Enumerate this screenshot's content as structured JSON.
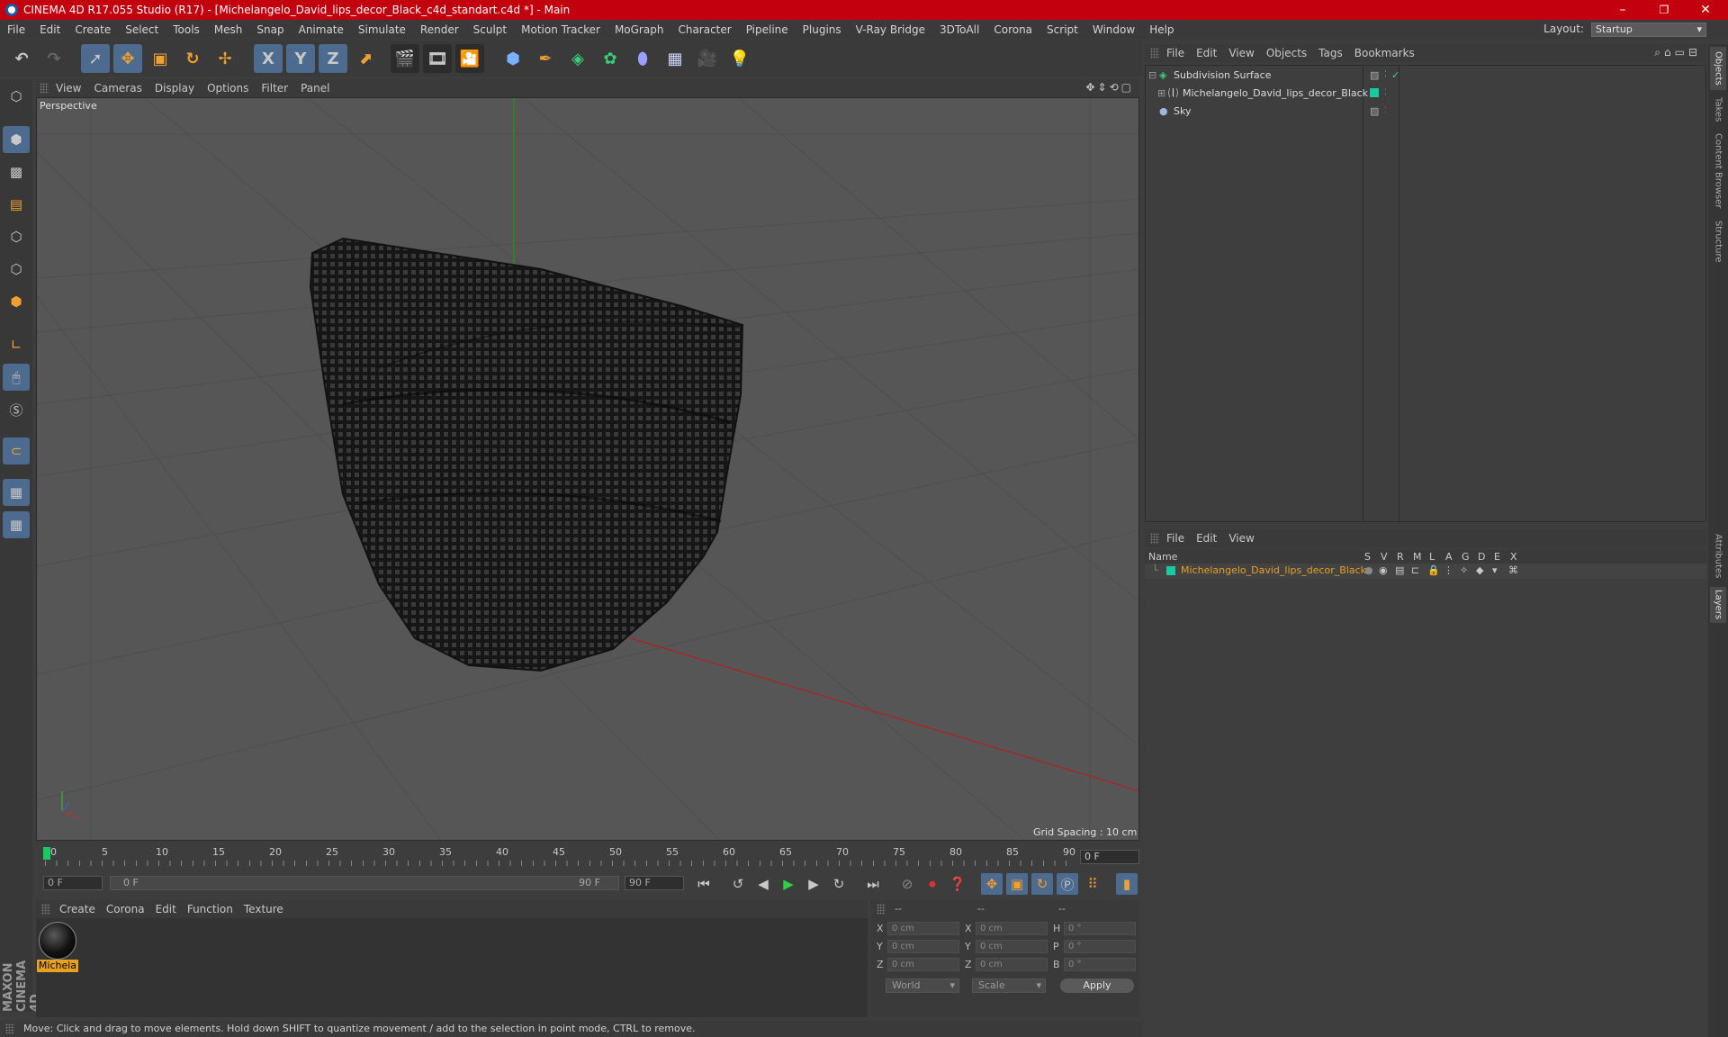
{
  "window": {
    "title": "CINEMA 4D R17.055 Studio (R17) - [Michelangelo_David_lips_decor_Black_c4d_standart.c4d *] - Main",
    "min_glyph": "–",
    "max_glyph": "❐",
    "close_glyph": "✕"
  },
  "menu": [
    "File",
    "Edit",
    "Create",
    "Select",
    "Tools",
    "Mesh",
    "Snap",
    "Animate",
    "Simulate",
    "Render",
    "Sculpt",
    "Motion Tracker",
    "MoGraph",
    "Character",
    "Pipeline",
    "Plugins",
    "V-Ray Bridge",
    "3DToAll",
    "Corona",
    "Script",
    "Window",
    "Help"
  ],
  "layout": {
    "label": "Layout:",
    "value": "Startup"
  },
  "toolbar": {
    "x_label": "X",
    "y_label": "Y",
    "z_label": "Z"
  },
  "viewport": {
    "menu": [
      "View",
      "Cameras",
      "Display",
      "Options",
      "Filter",
      "Panel"
    ],
    "label": "Perspective",
    "grid_spacing": "Grid Spacing : 10 cm"
  },
  "timeline": {
    "ticks": [
      "0",
      "5",
      "10",
      "15",
      "20",
      "25",
      "30",
      "35",
      "40",
      "45",
      "50",
      "55",
      "60",
      "65",
      "70",
      "75",
      "80",
      "85",
      "90"
    ],
    "current_frame": "0 F",
    "start_field": "0 F",
    "range_start": "0 F",
    "range_end": "90 F",
    "end_field": "90 F"
  },
  "materials": {
    "menu": [
      "Create",
      "Corona",
      "Edit",
      "Function",
      "Texture"
    ],
    "items": [
      {
        "label": "Michela"
      }
    ]
  },
  "coords": {
    "header": [
      "--",
      "--",
      "--"
    ],
    "rows": [
      {
        "a": "X",
        "av": "0 cm",
        "b": "X",
        "bv": "0 cm",
        "c": "H",
        "cv": "0 °"
      },
      {
        "a": "Y",
        "av": "0 cm",
        "b": "Y",
        "bv": "0 cm",
        "c": "P",
        "cv": "0 °"
      },
      {
        "a": "Z",
        "av": "0 cm",
        "b": "Z",
        "bv": "0 cm",
        "c": "B",
        "cv": "0 °"
      }
    ],
    "mode1": "World",
    "mode2": "Scale",
    "apply": "Apply"
  },
  "status": "Move: Click and drag to move elements. Hold down SHIFT to quantize movement / add to the selection in point mode, CTRL to remove.",
  "objects": {
    "menu": [
      "File",
      "Edit",
      "View",
      "Objects",
      "Tags",
      "Bookmarks"
    ],
    "items": [
      {
        "name": "Subdivision Surface"
      },
      {
        "name": "Michelangelo_David_lips_decor_Black"
      },
      {
        "name": "Sky"
      }
    ]
  },
  "layers": {
    "menu": [
      "File",
      "Edit",
      "View"
    ],
    "columns": [
      "Name",
      "S",
      "V",
      "R",
      "M",
      "L",
      "A",
      "G",
      "D",
      "E",
      "X"
    ],
    "items": [
      {
        "name": "Michelangelo_David_lips_decor_Black",
        "color": "#e8a020"
      }
    ]
  },
  "side_tabs": [
    "Objects",
    "Takes",
    "Content Browser",
    "Structure",
    "Attributes",
    "Layers"
  ],
  "brand": "MAXON CINEMA 4D",
  "colors": {
    "title_bar": "#c2000e",
    "accent_blue": "#4d6a8f",
    "object_green": "#19c9a0",
    "layer_orange": "#e8a020"
  }
}
